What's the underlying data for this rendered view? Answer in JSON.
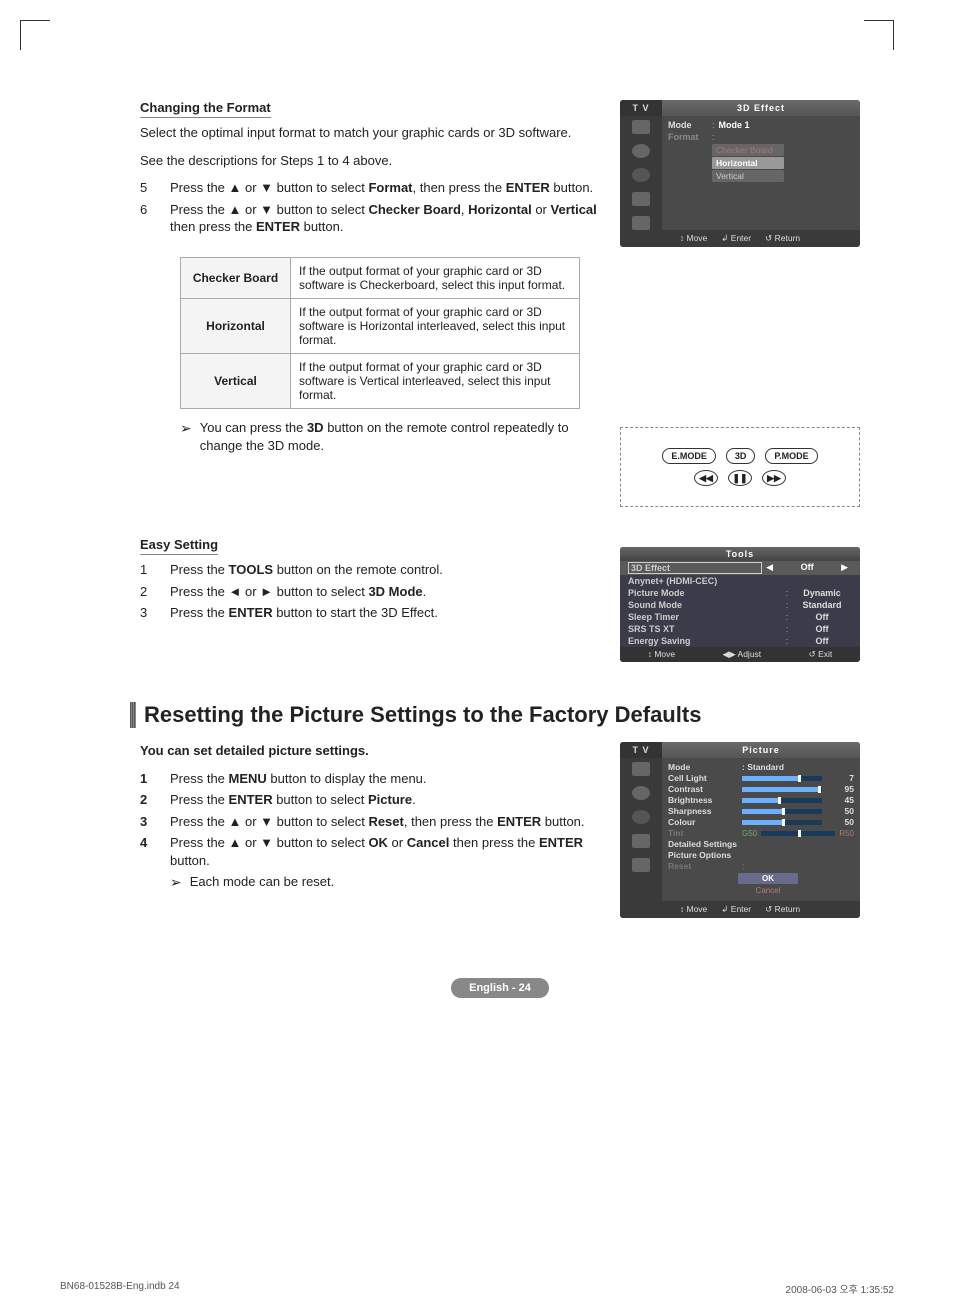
{
  "section1": {
    "heading": "Changing the Format",
    "p1": "Select the optimal input format to match your graphic cards or 3D software.",
    "p2": "See the descriptions for Steps 1 to 4 above.",
    "steps": [
      {
        "n": "5",
        "pre": "Press the ▲ or ▼ button to select ",
        "b1": "Format",
        "mid": ", then press the ",
        "b2": "ENTER",
        "post": " button."
      },
      {
        "n": "6",
        "pre": "Press the ▲ or ▼ button to select ",
        "b1": "Checker Board",
        "mid": ", ",
        "b2": "Horizontal",
        "mid2": " or ",
        "b3": "Vertical",
        "post": " then press the ",
        "b4": "ENTER",
        "post2": " button."
      }
    ],
    "table": [
      {
        "label": "Checker Board",
        "desc": "If the output format of your graphic card or 3D software is Checkerboard, select this input format."
      },
      {
        "label": "Horizontal",
        "desc": "If the output format of your graphic card or 3D software is Horizontal interleaved, select this input format."
      },
      {
        "label": "Vertical",
        "desc": "If the output format of your graphic card or 3D software is Vertical interleaved, select this input format."
      }
    ],
    "note_pre": "You can press the ",
    "note_b": "3D",
    "note_post": " button on the remote control repeatedly to change the 3D mode."
  },
  "osd1": {
    "tv": "T V",
    "title": "3D Effect",
    "mode_k": "Mode",
    "mode_v": "Mode 1",
    "format_k": "Format",
    "opts": [
      "Checker Board",
      "Horizontal",
      "Vertical"
    ],
    "sel_index": 1,
    "foot": [
      "Move",
      "Enter",
      "Return"
    ],
    "foot_icons": [
      "↕",
      "↲",
      "↺"
    ]
  },
  "remote": {
    "row1": [
      "E.MODE",
      "3D",
      "P.MODE"
    ],
    "row2": [
      "◀◀",
      "❚❚",
      "▶▶"
    ]
  },
  "easy": {
    "heading": "Easy Setting",
    "steps": [
      {
        "n": "1",
        "pre": "Press the ",
        "b1": "TOOLS",
        "post": " button on the remote control."
      },
      {
        "n": "2",
        "pre": "Press the ◄ or ► button to select ",
        "b1": "3D Mode",
        "post": "."
      },
      {
        "n": "3",
        "pre": "Press the ",
        "b1": "ENTER",
        "post": " button to start the 3D Effect."
      }
    ]
  },
  "tools": {
    "title": "Tools",
    "rows": [
      {
        "k": "3D Effect",
        "v": "Off",
        "hi": true,
        "arrows": true
      },
      {
        "k": "Anynet+ (HDMI-CEC)",
        "v": "",
        "sep": false
      },
      {
        "k": "Picture Mode",
        "v": "Dynamic",
        "sep": true
      },
      {
        "k": "Sound Mode",
        "v": "Standard",
        "sep": true
      },
      {
        "k": "Sleep Timer",
        "v": "Off",
        "sep": true
      },
      {
        "k": "SRS TS XT",
        "v": "Off",
        "sep": true
      },
      {
        "k": "Energy Saving",
        "v": "Off",
        "sep": true
      }
    ],
    "foot": [
      "Move",
      "Adjust",
      "Exit"
    ],
    "foot_icons": [
      "↕",
      "◀▶",
      "↺"
    ]
  },
  "reset": {
    "heading": "Resetting the Picture Settings to the Factory Defaults",
    "intro": "You can set detailed picture settings.",
    "steps": [
      {
        "n": "1",
        "pre": "Press the ",
        "b1": "MENU",
        "post": " button to display the menu."
      },
      {
        "n": "2",
        "pre": "Press the ",
        "b1": "ENTER",
        "post": " button to select ",
        "b2": "Picture",
        "post2": "."
      },
      {
        "n": "3",
        "pre": "Press the ▲ or ▼ button to select ",
        "b1": "Reset",
        "post": ", then press the ",
        "b2": "ENTER",
        "post2": " button."
      },
      {
        "n": "4",
        "pre": "Press the ▲ or ▼ button to select ",
        "b1": "OK",
        "mid": " or ",
        "b2": "Cancel",
        "post": " then press the ",
        "b3": "ENTER",
        "post2": " button."
      }
    ],
    "subnote": "Each mode can be reset."
  },
  "osd2": {
    "tv": "T V",
    "title": "Picture",
    "mode_k": "Mode",
    "mode_v": ": Standard",
    "sliders": [
      {
        "k": "Cell Light",
        "v": "7",
        "pct": 70
      },
      {
        "k": "Contrast",
        "v": "95",
        "pct": 95
      },
      {
        "k": "Brightness",
        "v": "45",
        "pct": 45
      },
      {
        "k": "Sharpness",
        "v": "50",
        "pct": 50
      },
      {
        "k": "Colour",
        "v": "50",
        "pct": 50
      }
    ],
    "tint": {
      "k": "Tint",
      "l": "G50",
      "r": "R50",
      "pct": 50
    },
    "extras": [
      "Detailed Settings",
      "Picture Options"
    ],
    "reset_k": "Reset",
    "ok": "OK",
    "cancel": "Cancel",
    "foot": [
      "Move",
      "Enter",
      "Return"
    ],
    "foot_icons": [
      "↕",
      "↲",
      "↺"
    ]
  },
  "pagefoot": "English - 24",
  "print": {
    "left": "BN68-01528B-Eng.indb   24",
    "right": "2008-06-03   오후 1:35:52"
  }
}
